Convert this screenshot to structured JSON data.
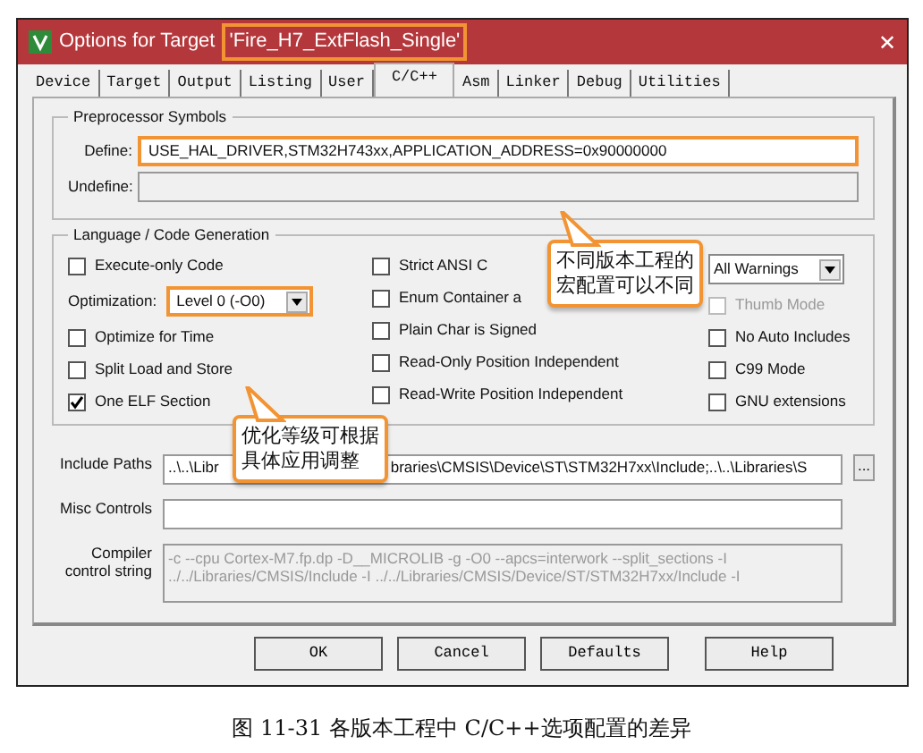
{
  "window": {
    "title": "Options for Target ",
    "target": "'Fire_H7_ExtFlash_Single'",
    "close": "✕"
  },
  "tabs": [
    {
      "label": "Device",
      "selected": false
    },
    {
      "label": "Target",
      "selected": false
    },
    {
      "label": "Output",
      "selected": false
    },
    {
      "label": "Listing",
      "selected": false
    },
    {
      "label": "User",
      "selected": false
    },
    {
      "label": "C/C++",
      "selected": true
    },
    {
      "label": "Asm",
      "selected": false
    },
    {
      "label": "Linker",
      "selected": false
    },
    {
      "label": "Debug",
      "selected": false
    },
    {
      "label": "Utilities",
      "selected": false
    }
  ],
  "preprocessor": {
    "title": "Preprocessor Symbols",
    "fields": [
      {
        "label": "Define:",
        "value": "USE_HAL_DRIVER,STM32H743xx,APPLICATION_ADDRESS=0x90000000",
        "highlighted": true
      },
      {
        "label": "Undefine:",
        "highlighted": false,
        "disabled": true
      }
    ]
  },
  "language": {
    "title": "Language / Code Generation",
    "columns": [
      [
        {
          "kind": "checkbox",
          "label": "Execute-only Code",
          "checked": false,
          "disabled": false
        },
        {
          "kind": "select",
          "label": "Optimization:",
          "value": "Level 0 (-O0)",
          "highlighted": true
        },
        {
          "kind": "checkbox",
          "label": "Optimize for Time",
          "checked": false,
          "disabled": false
        },
        {
          "kind": "checkbox",
          "label": "Split Load and Store",
          "checked": false,
          "disabled": false
        },
        {
          "kind": "checkbox",
          "label": "One ELF Section",
          "checked": true,
          "disabled": false
        }
      ],
      [
        {
          "kind": "checkbox",
          "label": "Strict ANSI C",
          "checked": false,
          "disabled": false
        },
        {
          "kind": "checkbox",
          "label": "Enum Container a",
          "checked": false,
          "disabled": false
        },
        {
          "kind": "checkbox",
          "label": "Plain Char is Signed",
          "checked": false,
          "disabled": false
        },
        {
          "kind": "checkbox",
          "label": "Read-Only Position Independent",
          "checked": false,
          "disabled": false
        },
        {
          "kind": "checkbox",
          "label": "Read-Write Position Independent",
          "checked": false,
          "disabled": false
        }
      ],
      [
        {
          "kind": "select",
          "value": "All Warnings",
          "highlighted": false
        },
        {
          "kind": "checkbox",
          "label": "Thumb Mode",
          "checked": false,
          "disabled": true
        },
        {
          "kind": "checkbox",
          "label": "No Auto Includes",
          "checked": false,
          "disabled": false
        },
        {
          "kind": "checkbox",
          "label": "C99 Mode",
          "checked": false,
          "disabled": false
        },
        {
          "kind": "checkbox",
          "label": "GNU extensions",
          "checked": false,
          "disabled": false
        }
      ]
    ]
  },
  "include_paths": {
    "label": "Include Paths",
    "visible_parts": [
      "..\\..\\Libr",
      "braries\\CMSIS\\Device\\ST\\STM32H7xx\\Include;..\\..\\Libraries\\S"
    ],
    "browse": "..."
  },
  "misc_controls": {
    "label": "Misc Controls"
  },
  "compiler_string": {
    "label": "Compiler control string",
    "lines": [
      "-c --cpu Cortex-M7.fp.dp -D__MICROLIB -g -O0 --apcs=interwork --split_sections -I",
      "../../Libraries/CMSIS/Include -I ../../Libraries/CMSIS/Device/ST/STM32H7xx/Include -I"
    ]
  },
  "buttons": [
    "OK",
    "Cancel",
    "Defaults",
    "Help"
  ],
  "callouts": [
    {
      "text": "不同版本工程的宏配置可以不同"
    },
    {
      "text": "优化等级可根据具体应用调整"
    }
  ],
  "caption": "图 11-31 各版本工程中 C/C++选项配置的差异"
}
